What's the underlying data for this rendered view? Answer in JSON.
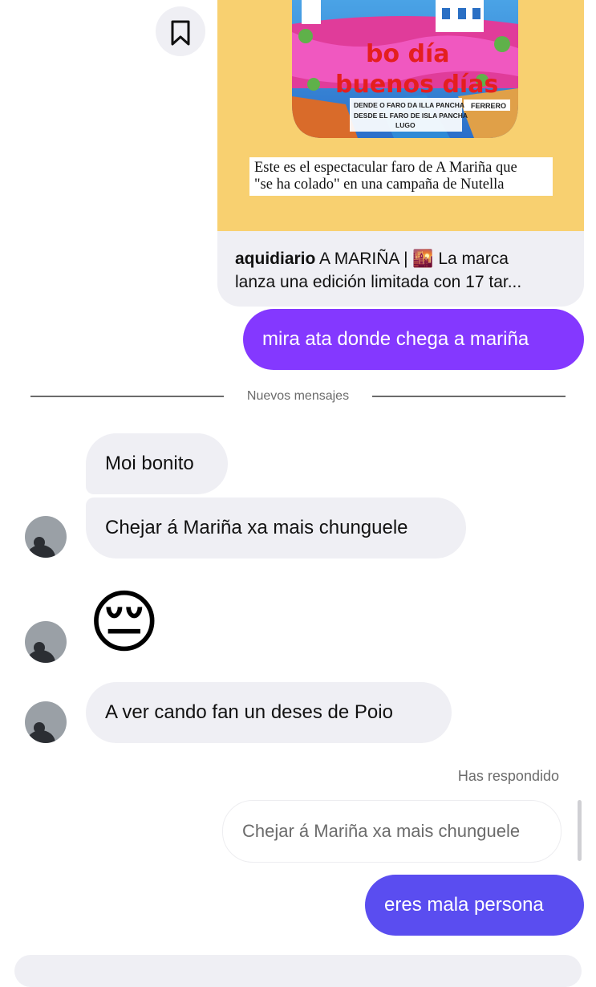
{
  "colors": {
    "sent_bubble_purple": "#8438ff",
    "sent_bubble_blue": "#5a4df0",
    "received_bubble": "#efeff4",
    "card_background": "#f8d070"
  },
  "shared_post": {
    "image_lines": [
      "bo día",
      "buenos días"
    ],
    "small_lines": [
      "DENDE O FARO DA ILLA PANCHA",
      "DESDE EL FARO DE ISLA PANCHA",
      "LUGO"
    ],
    "brand": "FERRERO",
    "caption_line1": "Este es el espectacular faro de A Mariña que",
    "caption_line2": "\"se ha colado\" en una campaña de Nutella",
    "author": "aquidiario",
    "text_line1": "A MARIÑA | 🌇 La marca",
    "text_line2": "lanza una edición limitada con 17 tar...",
    "save_icon": "bookmark-icon"
  },
  "messages": {
    "sent_1": "mira ata donde chega a mariña",
    "divider": "Nuevos mensajes",
    "recv_1": "Moi bonito",
    "recv_2": "Chejar á Mariña xa mais chunguele",
    "recv_emoji": "😔",
    "recv_3": "A ver cando fan un deses de Poio",
    "reply_label": "Has respondido",
    "quoted": "Chejar á Mariña xa mais chunguele",
    "sent_2": "eres mala persona"
  }
}
